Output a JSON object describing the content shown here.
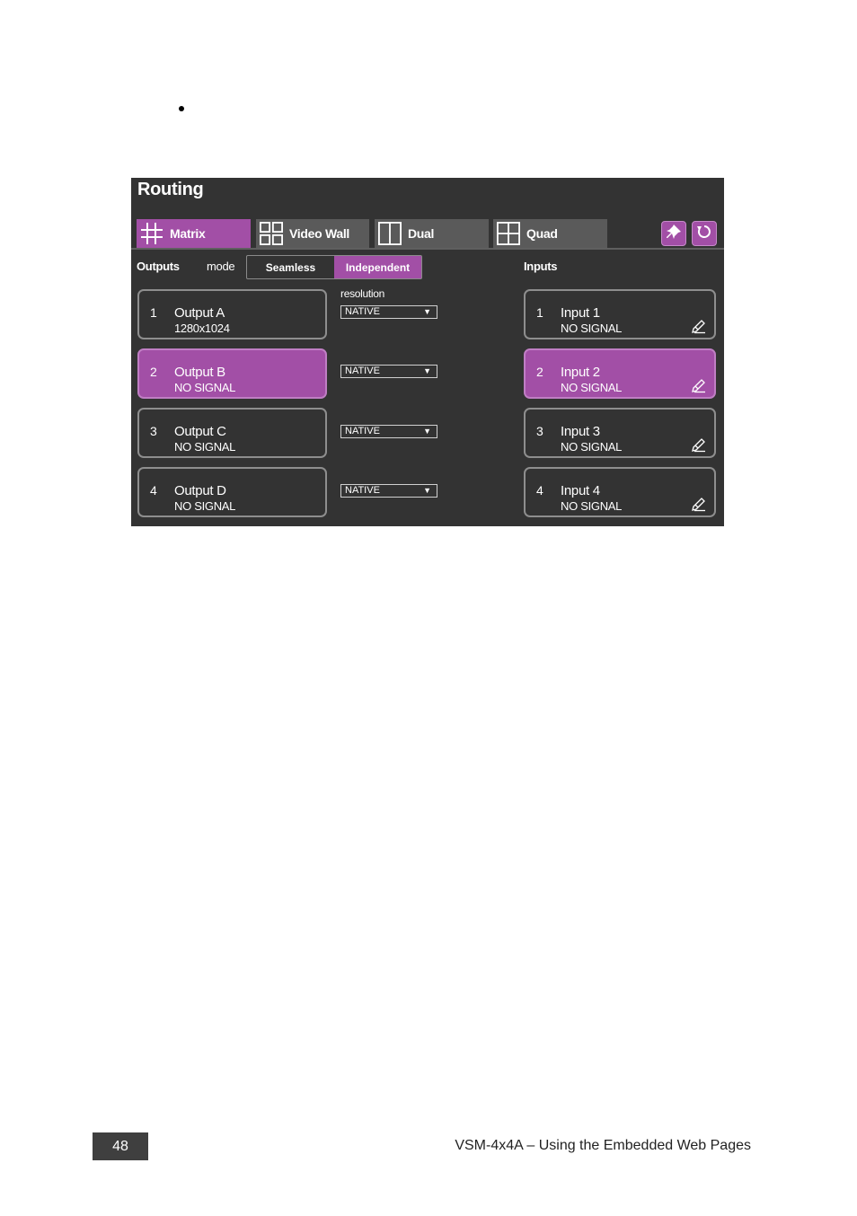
{
  "panel": {
    "title": "Routing",
    "tabs": [
      {
        "label": "Matrix",
        "icon": "matrix-grid-icon",
        "active": true
      },
      {
        "label": "Video Wall",
        "icon": "video-wall-icon",
        "active": false
      },
      {
        "label": "Dual",
        "icon": "dual-layout-icon",
        "active": false
      },
      {
        "label": "Quad",
        "icon": "quad-layout-icon",
        "active": false
      }
    ],
    "actions": [
      {
        "icon": "pin-icon"
      },
      {
        "icon": "refresh-icon"
      }
    ],
    "outputs_label": "Outputs",
    "mode_label": "mode",
    "mode_options": [
      {
        "label": "Seamless",
        "active": false
      },
      {
        "label": "Independent",
        "active": true
      }
    ],
    "resolution_label": "resolution",
    "inputs_label": "Inputs",
    "outputs": [
      {
        "num": "1",
        "name": "Output A",
        "sub": "1280x1024",
        "resolution": "NATIVE",
        "selected": false
      },
      {
        "num": "2",
        "name": "Output B",
        "sub": "NO SIGNAL",
        "resolution": "NATIVE",
        "selected": true
      },
      {
        "num": "3",
        "name": "Output C",
        "sub": "NO SIGNAL",
        "resolution": "NATIVE",
        "selected": false
      },
      {
        "num": "4",
        "name": "Output D",
        "sub": "NO SIGNAL",
        "resolution": "NATIVE",
        "selected": false
      }
    ],
    "inputs": [
      {
        "num": "1",
        "name": "Input 1",
        "sub": "NO SIGNAL",
        "selected": false
      },
      {
        "num": "2",
        "name": "Input 2",
        "sub": "NO SIGNAL",
        "selected": true
      },
      {
        "num": "3",
        "name": "Input 3",
        "sub": "NO SIGNAL",
        "selected": false
      },
      {
        "num": "4",
        "name": "Input 4",
        "sub": "NO SIGNAL",
        "selected": false
      }
    ],
    "colors": {
      "accent": "#a24fa6",
      "panel_bg": "#333333",
      "tab_bg": "#5a5a5a"
    }
  },
  "footer": {
    "page_number": "48",
    "doc_title": "VSM-4x4A – Using the Embedded Web Pages"
  }
}
